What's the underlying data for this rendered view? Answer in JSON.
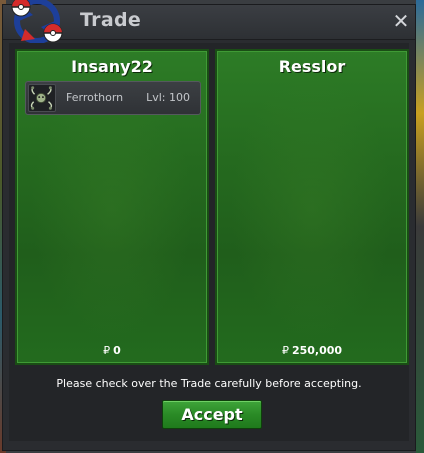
{
  "window": {
    "title": "Trade",
    "close_icon": "close-icon",
    "logo_icon": "pokeball-trade-icon"
  },
  "left_panel": {
    "player_name": "Insany22",
    "items": [
      {
        "icon": "ferrothorn-sprite-icon",
        "name": "Ferrothorn",
        "level": "Lvl: 100"
      }
    ],
    "currency_symbol": "₽",
    "money": "0"
  },
  "right_panel": {
    "player_name": "Resslor",
    "items": [],
    "currency_symbol": "₽",
    "money": "250,000"
  },
  "notice": "Please check over the Trade carefully before accepting.",
  "accept_label": "Accept",
  "colors": {
    "panel_green": "#256a1f",
    "accept_green": "#2a8a26",
    "window_bg": "#2a2c30",
    "title_text": "#c9cbcf"
  }
}
